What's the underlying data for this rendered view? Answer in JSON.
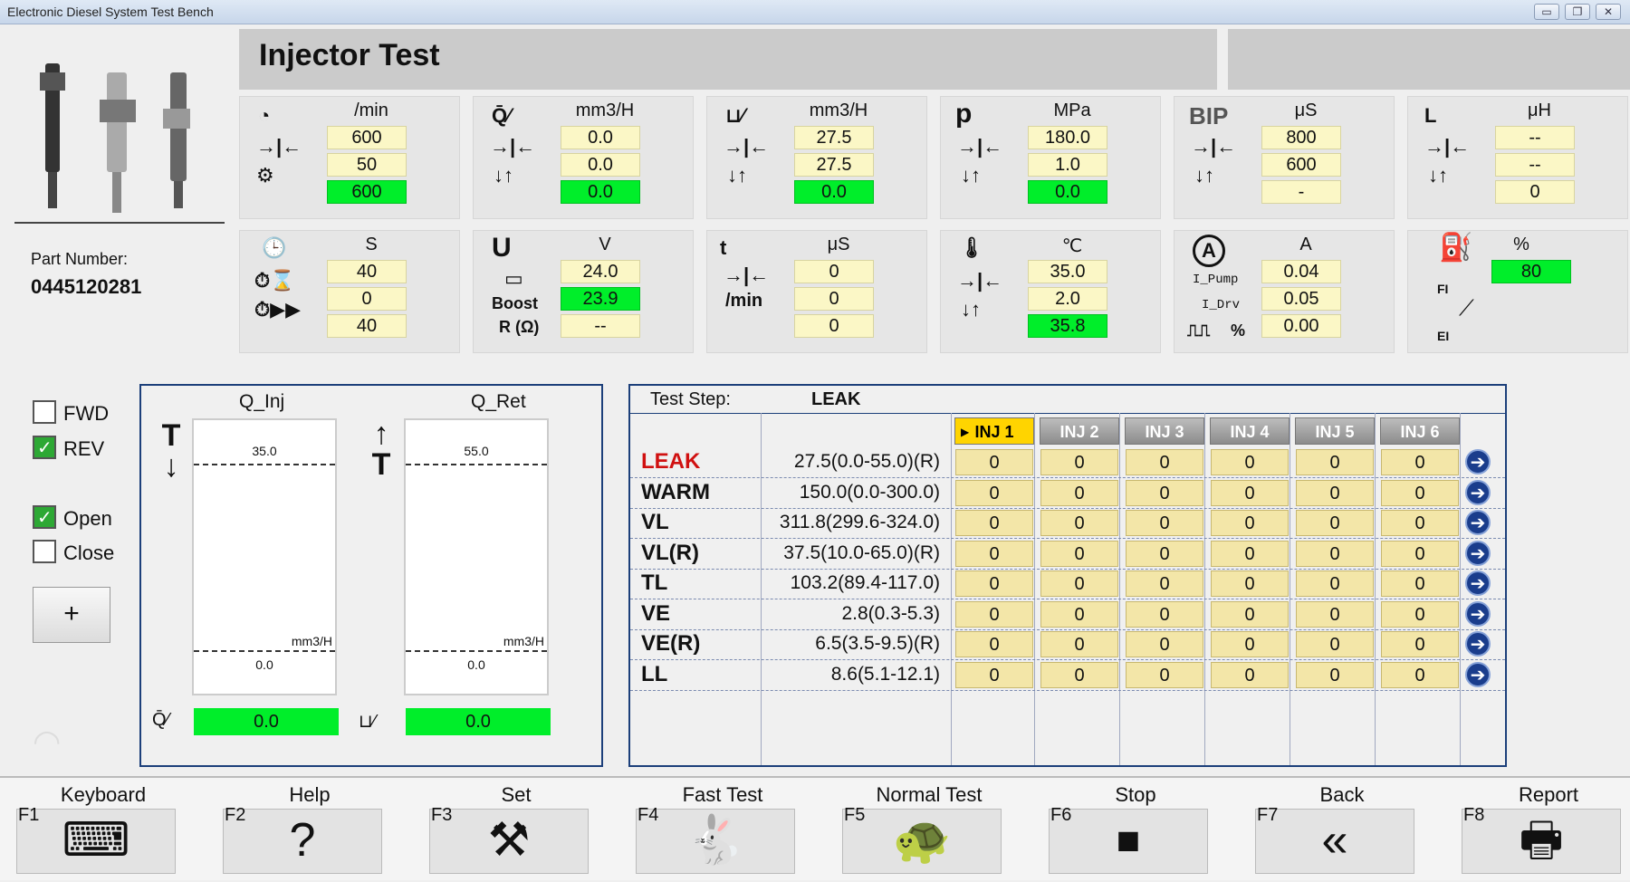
{
  "window": {
    "title": "Electronic Diesel System Test Bench"
  },
  "page": {
    "title": "Injector Test"
  },
  "part": {
    "label": "Part Number:",
    "value": "0445120281"
  },
  "panels": {
    "speed": {
      "unit": "/min",
      "v1": "600",
      "v2": "50",
      "v3": "600"
    },
    "qinj": {
      "unit": "mm3/H",
      "v1": "0.0",
      "v2": "0.0",
      "v3": "0.0"
    },
    "qret": {
      "unit": "mm3/H",
      "v1": "27.5",
      "v2": "27.5",
      "v3": "0.0"
    },
    "pressure": {
      "unit": "MPa",
      "v1": "180.0",
      "v2": "1.0",
      "v3": "0.0"
    },
    "bip": {
      "icon_text": "BIP",
      "unit": "μS",
      "v1": "800",
      "v2": "600",
      "v3": "-"
    },
    "inductance": {
      "icon_text": "L",
      "unit": "μH",
      "v1": "--",
      "v2": "--",
      "v3": "0"
    },
    "time": {
      "unit": "S",
      "v1": "40",
      "v2": "0",
      "v3": "40"
    },
    "voltage": {
      "icon_text": "U",
      "boost_label": "Boost",
      "r_label": "R (Ω)",
      "unit": "V",
      "v1": "24.0",
      "v2": "23.9",
      "v3": "--"
    },
    "pulse": {
      "icon_text": "t",
      "min_label": "/min",
      "unit": "μS",
      "v1": "0",
      "v2": "0",
      "v3": "0"
    },
    "temperature": {
      "unit": "℃",
      "v1": "35.0",
      "v2": "2.0",
      "v3": "35.8"
    },
    "current": {
      "icon_text": "A",
      "ipump_label": "I_Pump",
      "idrv_label": "I_Drv",
      "duty_label": "%",
      "unit": "A",
      "v1": "0.04",
      "v2": "0.05",
      "v3": "0.00"
    },
    "fuel": {
      "unit": "%",
      "v1": "80",
      "fi_label": "FI",
      "ei_label": "EI"
    }
  },
  "direction": {
    "fwd": "FWD",
    "rev": "REV",
    "open": "Open",
    "close": "Close",
    "plus": "+"
  },
  "gauges": {
    "qinj": {
      "title": "Q_Inj",
      "top": "35.0",
      "bottom": "0.0",
      "unit": "mm3/H",
      "value": "0.0"
    },
    "qret": {
      "title": "Q_Ret",
      "top": "55.0",
      "bottom": "0.0",
      "unit": "mm3/H",
      "value": "0.0"
    }
  },
  "table": {
    "step_label": "Test Step:",
    "step_value": "LEAK",
    "columns": [
      "INJ 1",
      "INJ 2",
      "INJ 3",
      "INJ 4",
      "INJ 5",
      "INJ 6"
    ],
    "rows": [
      {
        "name": "LEAK",
        "range": "27.5(0.0-55.0)(R)",
        "values": [
          "0",
          "0",
          "0",
          "0",
          "0",
          "0"
        ]
      },
      {
        "name": "WARM",
        "range": "150.0(0.0-300.0)",
        "values": [
          "0",
          "0",
          "0",
          "0",
          "0",
          "0"
        ]
      },
      {
        "name": "VL",
        "range": "311.8(299.6-324.0)",
        "values": [
          "0",
          "0",
          "0",
          "0",
          "0",
          "0"
        ]
      },
      {
        "name": "VL(R)",
        "range": "37.5(10.0-65.0)(R)",
        "values": [
          "0",
          "0",
          "0",
          "0",
          "0",
          "0"
        ]
      },
      {
        "name": "TL",
        "range": "103.2(89.4-117.0)",
        "values": [
          "0",
          "0",
          "0",
          "0",
          "0",
          "0"
        ]
      },
      {
        "name": "VE",
        "range": "2.8(0.3-5.3)",
        "values": [
          "0",
          "0",
          "0",
          "0",
          "0",
          "0"
        ]
      },
      {
        "name": "VE(R)",
        "range": "6.5(3.5-9.5)(R)",
        "values": [
          "0",
          "0",
          "0",
          "0",
          "0",
          "0"
        ]
      },
      {
        "name": "LL",
        "range": "8.6(5.1-12.1)",
        "values": [
          "0",
          "0",
          "0",
          "0",
          "0",
          "0"
        ]
      }
    ]
  },
  "fkeys": [
    {
      "key": "F1",
      "label": "Keyboard",
      "icon": "keyboard-icon"
    },
    {
      "key": "F2",
      "label": "Help",
      "icon": "help-icon"
    },
    {
      "key": "F3",
      "label": "Set",
      "icon": "tools-icon"
    },
    {
      "key": "F4",
      "label": "Fast Test",
      "icon": "rabbit-icon"
    },
    {
      "key": "F5",
      "label": "Normal Test",
      "icon": "turtle-icon"
    },
    {
      "key": "F6",
      "label": "Stop",
      "icon": "stop-icon"
    },
    {
      "key": "F7",
      "label": "Back",
      "icon": "back-icon"
    },
    {
      "key": "F8",
      "label": "Report",
      "icon": "printer-icon"
    }
  ],
  "colors": {
    "green": "#00ee2a",
    "yellow": "#fbf7c6",
    "active_tab": "#ffd400",
    "leak_red": "#d01010",
    "frame_blue": "#1c3f7a"
  }
}
